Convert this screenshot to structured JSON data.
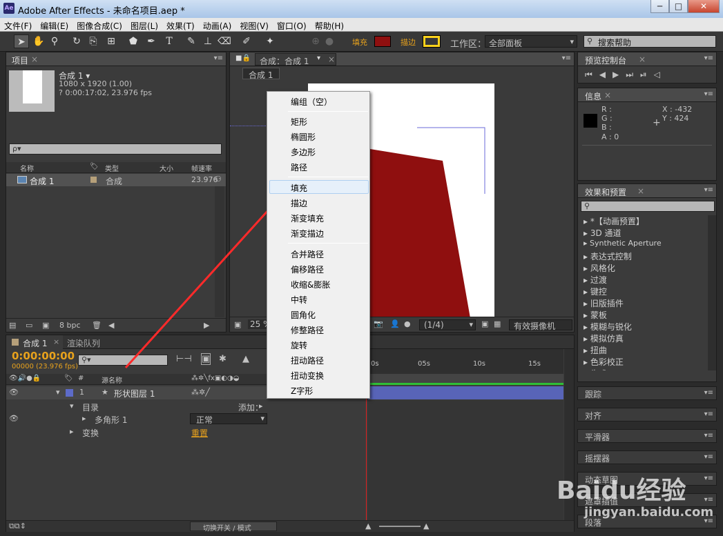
{
  "window": {
    "title": "Adobe After Effects - 未命名项目.aep *",
    "app_icon": "Ae",
    "min": "─",
    "max": "□",
    "close": "✕"
  },
  "menus": [
    "文件(F)",
    "编辑(E)",
    "图像合成(C)",
    "图层(L)",
    "效果(T)",
    "动画(A)",
    "视图(V)",
    "窗口(O)",
    "帮助(H)"
  ],
  "toolbar": {
    "fill_label": "填充",
    "stroke_label": "描边",
    "workspace_label": "工作区：",
    "workspace_value": "全部面板",
    "search_help": "搜索帮助",
    "fill_color": "#8f0f0f",
    "stroke_color": "#ffd31c"
  },
  "project": {
    "tab": "项目",
    "comp_name": "合成 1 ▾",
    "comp_size": "1080 x 1920 (1.00)",
    "comp_duration": "? 0:00:17:02, 23.976 fps",
    "search_placeholder": "ρ▾",
    "cols": [
      "名称",
      "类型",
      "大小",
      "帧速率"
    ],
    "row": {
      "name": "合成 1",
      "type": "合成",
      "fps": "23.976"
    },
    "bpc": "8 bpc"
  },
  "viewer": {
    "tab": "合成：合成 1",
    "subtab": "合成 1",
    "zoom": "25 %",
    "resolution": "(1/4)",
    "camera": "有效摄像机"
  },
  "context_menu": {
    "items": [
      "编组（空）",
      "矩形",
      "椭圆形",
      "多边形",
      "路径",
      "填充",
      "描边",
      "渐变填充",
      "渐变描边",
      "合并路径",
      "偏移路径",
      "收缩&膨胀",
      "中转",
      "圆角化",
      "修整路径",
      "旋转",
      "扭动路径",
      "扭动变换",
      "Z字形"
    ],
    "highlighted": "填充"
  },
  "timeline": {
    "tab": "合成 1",
    "tab2": "渲染队列",
    "timecode": "0:00:00:00",
    "frames": "00000 (23.976 fps)",
    "col_source": "源名称",
    "ticks": [
      "0s",
      "05s",
      "10s",
      "15s"
    ],
    "layer": {
      "index": "1",
      "name": "形状图层 1"
    },
    "contents": "目录",
    "add": "添加：",
    "polygon": "多角形 1",
    "blend": "正常",
    "transform": "变换",
    "reset": "重置",
    "bottom": "切换开关 / 模式"
  },
  "preview": {
    "tab": "预览控制台"
  },
  "info": {
    "tab": "信息",
    "r": "R :",
    "g": "G :",
    "b": "B :",
    "a": "A : 0",
    "x": "X : -432",
    "y": "Y : 424"
  },
  "effects": {
    "tab": "效果和预置",
    "items": [
      "*【动画预置】",
      "3D 通道",
      "Synthetic Aperture",
      "表达式控制",
      "风格化",
      "过渡",
      "键控",
      "旧版插件",
      "蒙板",
      "模糊与锐化",
      "模拟仿真",
      "扭曲",
      "色彩校正",
      "生成"
    ]
  },
  "side_panels": [
    "跟踪",
    "对齐",
    "平滑器",
    "摇摆器",
    "动态草图",
    "遮罩插值",
    "段落"
  ],
  "watermark": {
    "brand": "Baidu经验",
    "url": "jingyan.baidu.com"
  }
}
